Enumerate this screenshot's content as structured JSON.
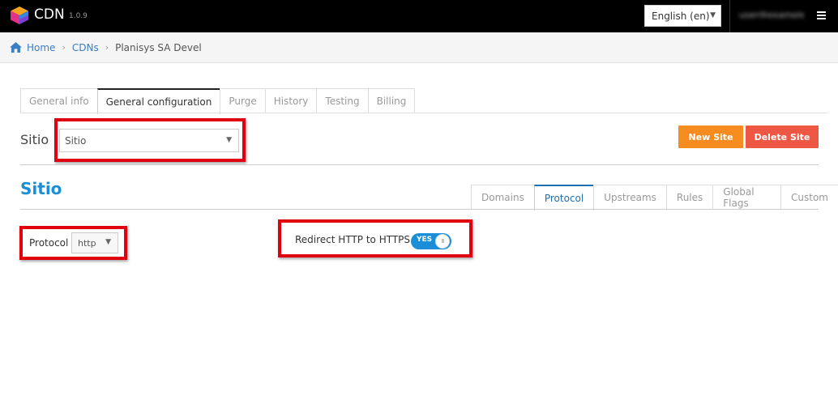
{
  "header": {
    "brand": "CDN",
    "version": "1.0.9",
    "language": "English (en)",
    "user": "user@example.com"
  },
  "breadcrumb": {
    "home": "Home",
    "cdns": "CDNs",
    "current": "Planisys SA Devel"
  },
  "main_tabs": [
    "General info",
    "General configuration",
    "Purge",
    "History",
    "Testing",
    "Billing"
  ],
  "site_selector": {
    "label": "Sitio",
    "value": "Sitio"
  },
  "buttons": {
    "new_site": "New Site",
    "delete_site": "Delete Site"
  },
  "site_title": "Sitio",
  "sub_tabs": [
    "Domains",
    "Protocol",
    "Upstreams",
    "Rules",
    "Global Flags",
    "Custom"
  ],
  "protocol": {
    "label": "Protocol",
    "value": "http"
  },
  "redirect": {
    "label": "Redirect HTTP to HTTPS",
    "toggle_text": "YES",
    "knob_text": "III"
  },
  "colors": {
    "accent_blue": "#1a8fd8",
    "new_site": "#f68c1f",
    "delete_site": "#ee5744",
    "highlight_red": "#e0000f"
  }
}
